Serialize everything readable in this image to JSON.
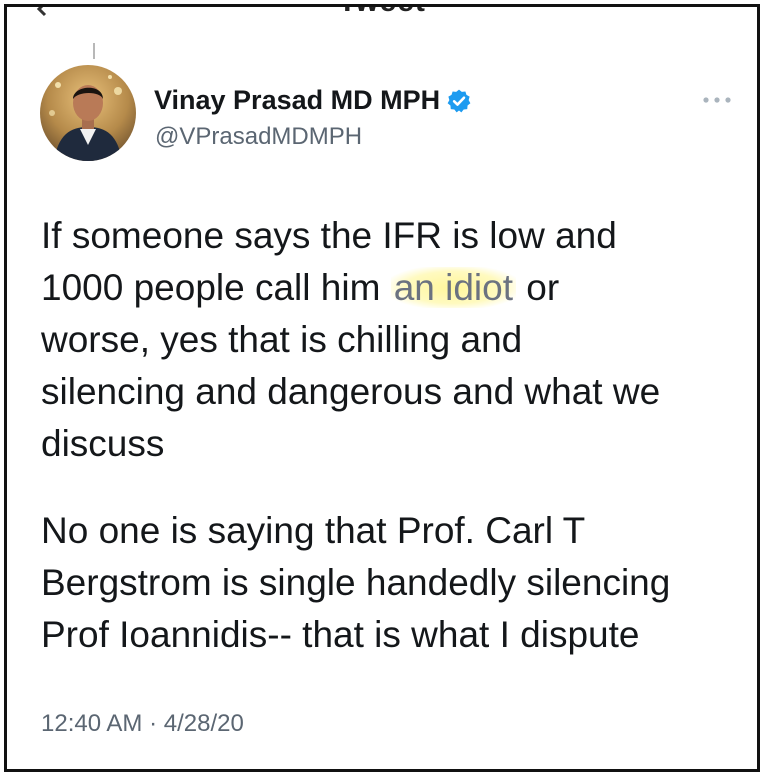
{
  "header": {
    "title": "Tweet"
  },
  "author": {
    "name": "Vinay Prasad MD MPH",
    "handle": "@VPrasadMDMPH",
    "verified": true,
    "avatar": "avatar-photo"
  },
  "tweet": {
    "paragraph1": {
      "line1": "If someone says the IFR is low and",
      "line2_before": "1000 people call him ",
      "line2_highlight": "an idiot",
      "line2_after": " or",
      "line3": "worse, yes that is chilling and",
      "line4": "silencing and dangerous and what we",
      "line5": "discuss"
    },
    "paragraph2": {
      "line1": "No one is saying that Prof. Carl T",
      "line2": "Bergstrom is single handedly silencing",
      "line3": "Prof Ioannidis-- that is what I dispute"
    },
    "timestamp": "12:40 AM · 4/28/20"
  },
  "icons": {
    "back": "back-arrow-icon",
    "verified": "verified-badge-icon",
    "more": "more-options-icon"
  },
  "colors": {
    "verified": "#1d9bf0",
    "highlight": "#fff596",
    "secondary_text": "#5b6672"
  }
}
